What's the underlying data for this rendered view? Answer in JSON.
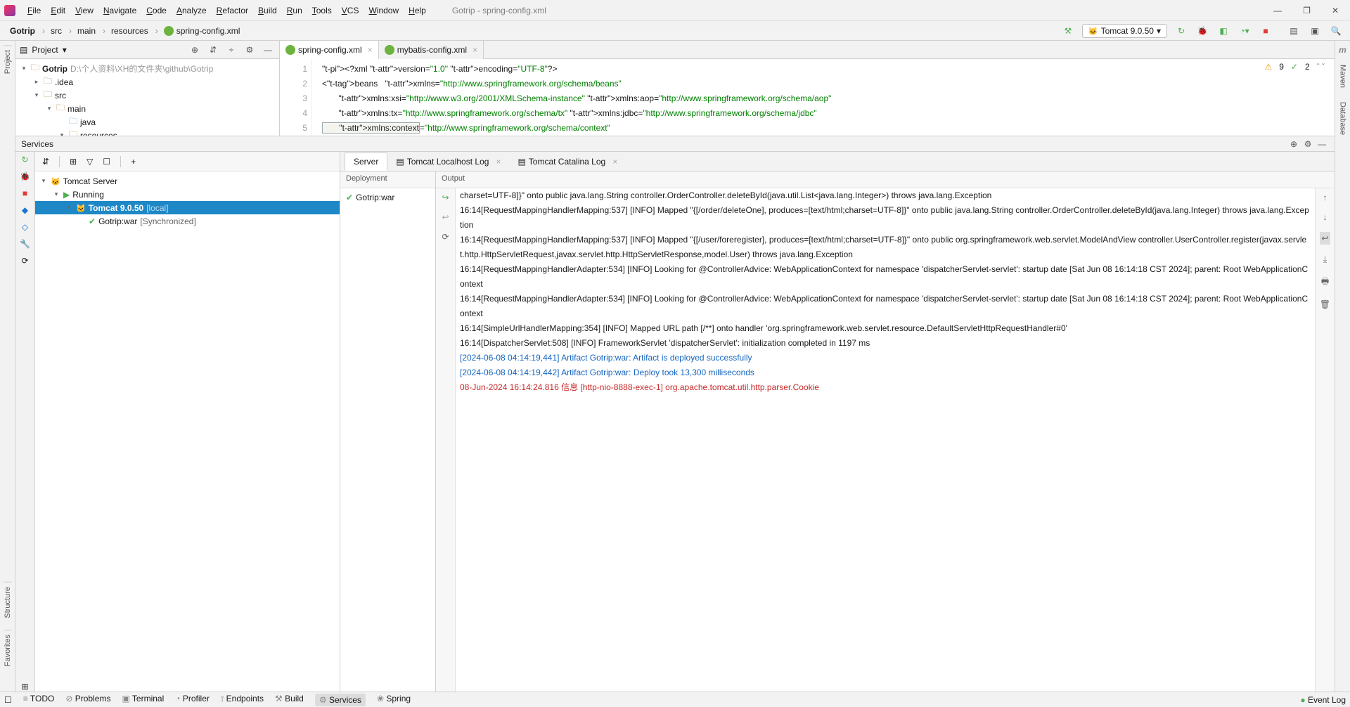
{
  "window_title": "Gotrip - spring-config.xml",
  "menubar": [
    "File",
    "Edit",
    "View",
    "Navigate",
    "Code",
    "Analyze",
    "Refactor",
    "Build",
    "Run",
    "Tools",
    "VCS",
    "Window",
    "Help"
  ],
  "breadcrumbs": [
    "Gotrip",
    "src",
    "main",
    "resources",
    "spring-config.xml"
  ],
  "run_config": "Tomcat 9.0.50",
  "project_panel": {
    "title": "Project",
    "root": {
      "name": "Gotrip",
      "path": "D:\\个人资料\\XH的文件夹\\github\\Gotrip"
    },
    "nodes": [
      {
        "indent": 1,
        "arrow": ">",
        "name": ".idea"
      },
      {
        "indent": 1,
        "arrow": "v",
        "name": "src"
      },
      {
        "indent": 2,
        "arrow": "v",
        "name": "main"
      },
      {
        "indent": 3,
        "arrow": "",
        "name": "java",
        "blue": true
      },
      {
        "indent": 3,
        "arrow": "v",
        "name": "resources"
      }
    ]
  },
  "editor_tabs": [
    {
      "name": "spring-config.xml",
      "active": true
    },
    {
      "name": "mybatis-config.xml",
      "active": false
    }
  ],
  "inspections": {
    "warn": "9",
    "ok": "2"
  },
  "code_lines": [
    "<?xml version=\"1.0\" encoding=\"UTF-8\"?>",
    "<beans   xmlns=\"http://www.springframework.org/schema/beans\"",
    "       xmlns:xsi=\"http://www.w3.org/2001/XMLSchema-instance\" xmlns:aop=\"http://www.springframework.org/schema/aop\"",
    "       xmlns:tx=\"http://www.springframework.org/schema/tx\" xmlns:jdbc=\"http://www.springframework.org/schema/jdbc\"",
    "       xmlns:context=\"http://www.springframework.org/schema/context\""
  ],
  "services_title": "Services",
  "svc_tree": [
    {
      "indent": 0,
      "arrow": "v",
      "icon": "tomcat",
      "label": "Tomcat Server"
    },
    {
      "indent": 1,
      "arrow": "v",
      "icon": "play",
      "label": "Running"
    },
    {
      "indent": 2,
      "arrow": "v",
      "icon": "tomcat",
      "label": "Tomcat 9.0.50",
      "suffix": "[local]",
      "selected": true
    },
    {
      "indent": 3,
      "arrow": "",
      "icon": "check",
      "label": "Gotrip:war",
      "suffix": "[Synchronized]"
    }
  ],
  "svc_tabs": [
    "Server",
    "Tomcat Localhost Log",
    "Tomcat Catalina Log"
  ],
  "deployment_header": "Deployment",
  "deployment_item": "Gotrip:war",
  "output_header": "Output",
  "output_lines": [
    {
      "t": "charset=UTF-8]}\" onto public java.lang.String controller.OrderController.deleteById(java.util.List<java.lang.Integer>) throws java.lang.Exception"
    },
    {
      "t": "16:14[RequestMappingHandlerMapping:537] [INFO] Mapped \"{[/order/deleteOne], produces=[text/html;charset=UTF-8]}\" onto public java.lang.String controller.OrderController.deleteById(java.lang.Integer) throws java.lang.Exception"
    },
    {
      "t": "16:14[RequestMappingHandlerMapping:537] [INFO] Mapped \"{[/user/foreregister], produces=[text/html;charset=UTF-8]}\" onto public org.springframework.web.servlet.ModelAndView controller.UserController.register(javax.servlet.http.HttpServletRequest,javax.servlet.http.HttpServletResponse,model.User) throws java.lang.Exception"
    },
    {
      "t": "16:14[RequestMappingHandlerAdapter:534] [INFO] Looking for @ControllerAdvice: WebApplicationContext for namespace 'dispatcherServlet-servlet': startup date [Sat Jun 08 16:14:18 CST 2024]; parent: Root WebApplicationContext"
    },
    {
      "t": "16:14[RequestMappingHandlerAdapter:534] [INFO] Looking for @ControllerAdvice: WebApplicationContext for namespace 'dispatcherServlet-servlet': startup date [Sat Jun 08 16:14:18 CST 2024]; parent: Root WebApplicationContext"
    },
    {
      "t": "16:14[SimpleUrlHandlerMapping:354] [INFO] Mapped URL path [/**] onto handler 'org.springframework.web.servlet.resource.DefaultServletHttpRequestHandler#0'"
    },
    {
      "t": "16:14[DispatcherServlet:508] [INFO] FrameworkServlet 'dispatcherServlet': initialization completed in 1197 ms"
    },
    {
      "t": "[2024-06-08 04:14:19,441] Artifact Gotrip:war: Artifact is deployed successfully",
      "c": "blue"
    },
    {
      "t": "[2024-06-08 04:14:19,442] Artifact Gotrip:war: Deploy took 13,300 milliseconds",
      "c": "blue"
    },
    {
      "t": "08-Jun-2024 16:14:24.816 信息 [http-nio-8888-exec-1] org.apache.tomcat.util.http.parser.Cookie",
      "c": "red"
    }
  ],
  "left_tools": [
    "Project",
    "Structure",
    "Favorites"
  ],
  "right_tools": [
    "Maven",
    "Database"
  ],
  "statusbar": [
    "TODO",
    "Problems",
    "Terminal",
    "Profiler",
    "Endpoints",
    "Build",
    "Services",
    "Spring"
  ],
  "event_log": "Event Log"
}
